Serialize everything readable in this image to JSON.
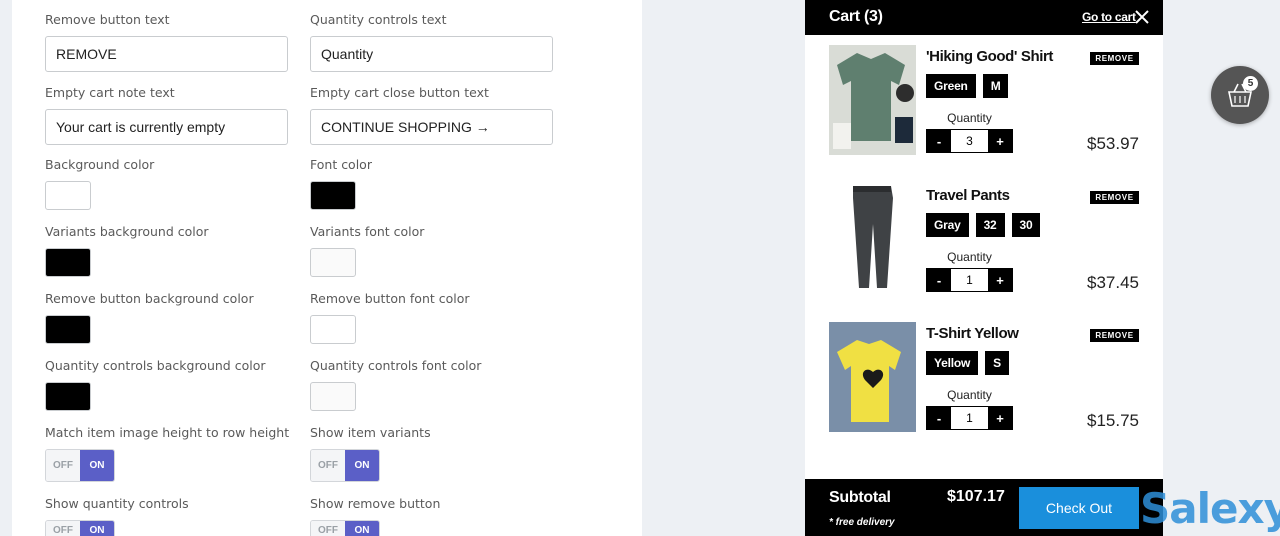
{
  "settings": {
    "fields": [
      {
        "label": "Remove button text",
        "value": "REMOVE"
      },
      {
        "label": "Quantity controls text",
        "value": "Quantity"
      },
      {
        "label": "Empty cart note text",
        "value": "Your cart is currently empty"
      },
      {
        "label": "Empty cart close button text",
        "value": "CONTINUE SHOPPING →"
      },
      {
        "label": "Background color",
        "color": "#ffffff"
      },
      {
        "label": "Font color",
        "color": "#000000"
      },
      {
        "label": "Variants background color",
        "color": "#000000"
      },
      {
        "label": "Variants font color",
        "color": "#ffffff"
      },
      {
        "label": "Remove button background color",
        "color": "#000000"
      },
      {
        "label": "Remove button font color",
        "color": "#ffffff"
      },
      {
        "label": "Quantity controls background color",
        "color": "#000000"
      },
      {
        "label": "Quantity controls font color",
        "color": "#ffffff"
      },
      {
        "label": "Match item image height to row height",
        "off": "OFF",
        "on": "ON",
        "state": "on"
      },
      {
        "label": "Show item variants",
        "off": "OFF",
        "on": "ON",
        "state": "on"
      },
      {
        "label": "Show quantity controls",
        "off": "OFF",
        "on": "ON",
        "state": "on"
      },
      {
        "label": "Show remove button",
        "off": "OFF",
        "on": "ON",
        "state": "on"
      }
    ]
  },
  "cart": {
    "title": "Cart (3)",
    "go_to_cart": "Go to cart",
    "close_icon": "close-icon",
    "items": [
      {
        "name": "'Hiking Good' Shirt",
        "remove": "REMOVE",
        "variants": [
          "Green",
          "M"
        ],
        "qty_label": "Quantity",
        "minus": "-",
        "qty": "3",
        "plus": "+",
        "price": "$53.97"
      },
      {
        "name": "Travel Pants",
        "remove": "REMOVE",
        "variants": [
          "Gray",
          "32",
          "30"
        ],
        "qty_label": "Quantity",
        "minus": "-",
        "qty": "1",
        "plus": "+",
        "price": "$37.45"
      },
      {
        "name": "T-Shirt Yellow",
        "remove": "REMOVE",
        "variants": [
          "Yellow",
          "S"
        ],
        "qty_label": "Quantity",
        "minus": "-",
        "qty": "1",
        "plus": "+",
        "price": "$15.75"
      }
    ],
    "subtotal_label": "Subtotal",
    "free_delivery": "* free delivery",
    "subtotal_value": "$107.17",
    "checkout": "Check Out"
  },
  "bubble": {
    "count": "5",
    "icon": "basket-icon"
  },
  "watermark": "Salexy",
  "colors": {
    "accent": "#5b5fc7",
    "checkout": "#1a8fdc"
  }
}
